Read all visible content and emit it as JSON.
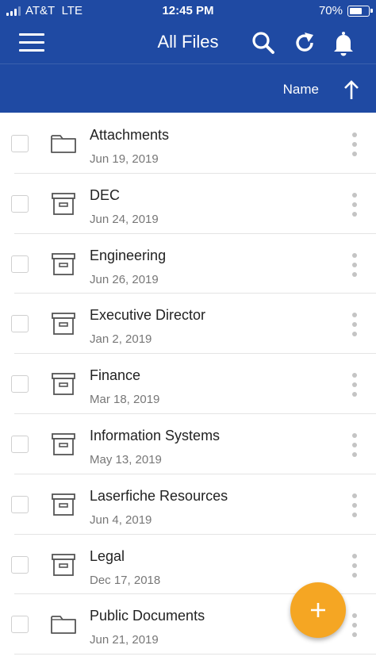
{
  "status_bar": {
    "carrier": "AT&T",
    "network": "LTE",
    "time": "12:45 PM",
    "battery": "70%",
    "battery_level": 0.7
  },
  "header": {
    "title": "All Files",
    "icons": [
      "hamburger-menu-icon",
      "search-icon",
      "refresh-icon",
      "bell-icon"
    ]
  },
  "sort": {
    "label": "Name",
    "direction": "ascending",
    "icon": "arrow-up-icon"
  },
  "files": [
    {
      "name": "Attachments",
      "date": "Jun 19, 2019",
      "icon": "folder-icon"
    },
    {
      "name": "DEC",
      "date": "Jun 24, 2019",
      "icon": "cabinet-icon"
    },
    {
      "name": "Engineering",
      "date": "Jun 26, 2019",
      "icon": "cabinet-icon"
    },
    {
      "name": "Executive Director",
      "date": "Jan 2, 2019",
      "icon": "cabinet-icon"
    },
    {
      "name": "Finance",
      "date": "Mar 18, 2019",
      "icon": "cabinet-icon"
    },
    {
      "name": "Information Systems",
      "date": "May 13, 2019",
      "icon": "cabinet-icon"
    },
    {
      "name": "Laserfiche Resources",
      "date": "Jun 4, 2019",
      "icon": "cabinet-icon"
    },
    {
      "name": "Legal",
      "date": "Dec 17, 2018",
      "icon": "cabinet-icon"
    },
    {
      "name": "Public Documents",
      "date": "Jun 21, 2019",
      "icon": "folder-icon"
    }
  ],
  "fab": {
    "icon": "plus-icon"
  },
  "colors": {
    "header": "#1f4aa3",
    "fab": "#f5a623",
    "divider": "#e4e4e4",
    "date_text": "#777777"
  }
}
